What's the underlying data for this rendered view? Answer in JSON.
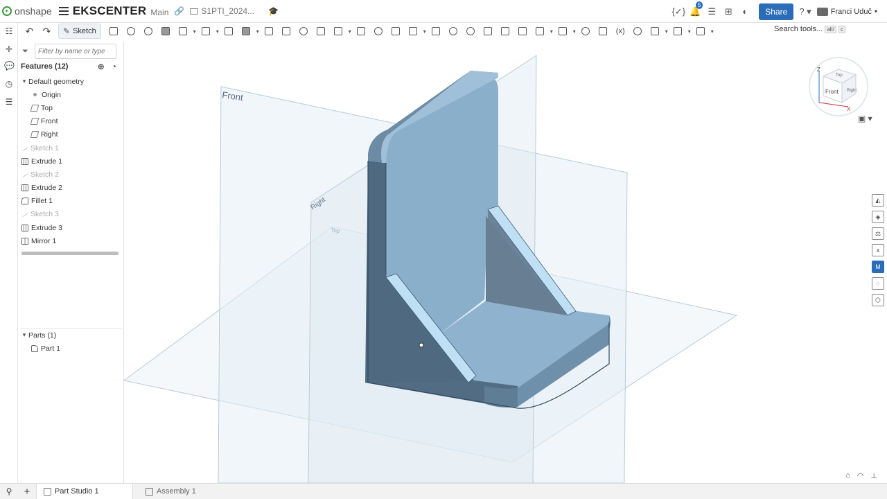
{
  "app": {
    "logo": "onshape",
    "doc_title": "EKSCENTER",
    "branch": "Main",
    "folder": "S1PTI_2024..."
  },
  "topbar": {
    "notif_count": "5",
    "share": "Share",
    "user": "Franci Uduč"
  },
  "toolbar": {
    "sketch": "Sketch",
    "search": "Search tools...",
    "search_kbd1": "alt/",
    "search_kbd2": "c"
  },
  "panel": {
    "filter_placeholder": "Filter by name or type",
    "features_header": "Features (12)",
    "default_geometry": "Default geometry",
    "items": [
      {
        "label": "Origin",
        "icon": "origin-icon",
        "dim": false,
        "indent": 1
      },
      {
        "label": "Top",
        "icon": "plane-icon",
        "dim": false,
        "indent": 1
      },
      {
        "label": "Front",
        "icon": "plane-icon",
        "dim": false,
        "indent": 1
      },
      {
        "label": "Right",
        "icon": "plane-icon",
        "dim": false,
        "indent": 1
      },
      {
        "label": "Sketch 1",
        "icon": "sketch-icon",
        "dim": true,
        "indent": 0
      },
      {
        "label": "Extrude 1",
        "icon": "extrude-icon",
        "dim": false,
        "indent": 0
      },
      {
        "label": "Sketch 2",
        "icon": "sketch-icon",
        "dim": true,
        "indent": 0
      },
      {
        "label": "Extrude 2",
        "icon": "extrude-icon",
        "dim": false,
        "indent": 0
      },
      {
        "label": "Fillet 1",
        "icon": "fillet-icon",
        "dim": false,
        "indent": 0
      },
      {
        "label": "Sketch 3",
        "icon": "sketch-icon",
        "dim": true,
        "indent": 0
      },
      {
        "label": "Extrude 3",
        "icon": "extrude-icon",
        "dim": false,
        "indent": 0
      },
      {
        "label": "Mirror 1",
        "icon": "mirror-icon",
        "dim": false,
        "indent": 0
      }
    ],
    "parts_header": "Parts (1)",
    "parts": [
      "Part 1"
    ]
  },
  "viewport": {
    "plane_front": "Front",
    "plane_right": "Right",
    "plane_top": "Top"
  },
  "viewcube": {
    "top": "Top",
    "front": "Front",
    "right": "Right",
    "axis_z": "Z",
    "axis_x": "X"
  },
  "tabs": [
    {
      "label": "Part Studio 1",
      "active": true
    },
    {
      "label": "Assembly 1",
      "active": false
    }
  ]
}
